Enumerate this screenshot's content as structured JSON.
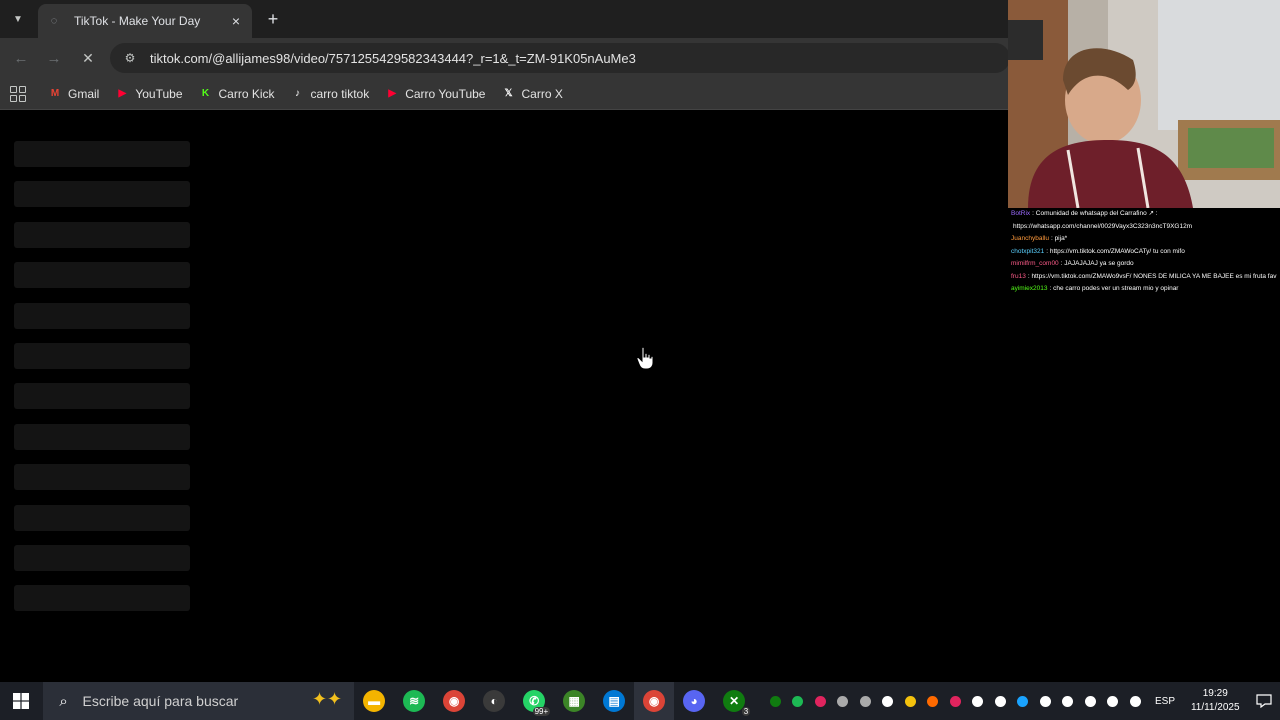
{
  "browser": {
    "tab": {
      "title": "TikTok - Make Your Day",
      "close_glyph": "×"
    },
    "new_tab_glyph": "+",
    "url": "tiktok.com/@allijames98/video/7571255429582343444?_r=1&_t=ZM-91K05nAuMe3",
    "bookmarks": [
      {
        "label": "Gmail",
        "icon": "gmail-icon",
        "color": "#ea4335",
        "glyph": "M"
      },
      {
        "label": "YouTube",
        "icon": "youtube-icon",
        "color": "#ff0033",
        "glyph": "▶"
      },
      {
        "label": "Carro Kick",
        "icon": "kick-icon",
        "color": "#53fc18",
        "glyph": "K"
      },
      {
        "label": "carro tiktok",
        "icon": "tiktok-icon",
        "color": "#ffffff",
        "glyph": "♪"
      },
      {
        "label": "Carro YouTube",
        "icon": "youtube-icon",
        "color": "#ff0033",
        "glyph": "▶"
      },
      {
        "label": "Carro X",
        "icon": "x-icon",
        "color": "#ffffff",
        "glyph": "𝕏"
      }
    ]
  },
  "page": {
    "skeleton_rows": 12
  },
  "stream_chat": [
    {
      "user": "BotRix",
      "user_color": "#9b6bff",
      "text": ": Comunidad de whatsapp del Carrafino ↗ :"
    },
    {
      "user": "",
      "user_color": "#ffffff",
      "text": "https://whatsapp.com/channel/0029Vayx3C323n3ncT9XG12m"
    },
    {
      "user": "Juanchyballu",
      "user_color": "#ff9a3c",
      "text": ": pija*"
    },
    {
      "user": "chotxpit321",
      "user_color": "#5bd1ff",
      "text": ": https://vm.tiktok.com/ZMAWoCATy/ tu con mifo"
    },
    {
      "user": "mimilfrm_com00",
      "user_color": "#ff5c8a",
      "text": ": JAJAJAJAJ ya se gordo"
    },
    {
      "user": "fru13",
      "user_color": "#ff5c8a",
      "text": ": https://vm.tiktok.com/ZMAWo9vsF/ NONES DE MILICA YA ME BAJEE es mi fruta fav"
    },
    {
      "user": "ayimiex2013",
      "user_color": "#53fc18",
      "text": ": che carro podes ver un stream mio y opinar"
    }
  ],
  "taskbar": {
    "search_placeholder": "Escribe aquí para buscar",
    "apps": [
      {
        "name": "file-explorer",
        "color": "#f4b400",
        "glyph": "▬"
      },
      {
        "name": "spotify",
        "color": "#1db954",
        "glyph": "≋"
      },
      {
        "name": "chrome",
        "color": "#db4437",
        "glyph": "◉"
      },
      {
        "name": "obs",
        "color": "#3a3a3a",
        "glyph": "◐"
      },
      {
        "name": "whatsapp",
        "color": "#25d366",
        "glyph": "✆",
        "badge": "99+"
      },
      {
        "name": "minecraft",
        "color": "#3c8527",
        "glyph": "▦"
      },
      {
        "name": "microsoft-store",
        "color": "#0078d4",
        "glyph": "▤"
      },
      {
        "name": "chrome-active",
        "color": "#db4437",
        "glyph": "◉",
        "active": true
      },
      {
        "name": "discord",
        "color": "#5865f2",
        "glyph": "◕"
      },
      {
        "name": "xbox",
        "color": "#107c10",
        "glyph": "✕",
        "badge": "3"
      }
    ],
    "tray_colors": [
      "#107c10",
      "#1db954",
      "#e0245e",
      "#aaaaaa",
      "#aaaaaa",
      "#ffffff",
      "#f4c20d",
      "#ff6a00",
      "#e0245e",
      "#ffffff",
      "#ffffff",
      "#1aa3ff",
      "#ffffff",
      "#ffffff",
      "#ffffff",
      "#ffffff",
      "#ffffff"
    ],
    "language": "ESP",
    "time": "19:29",
    "date": "11/11/2025"
  }
}
